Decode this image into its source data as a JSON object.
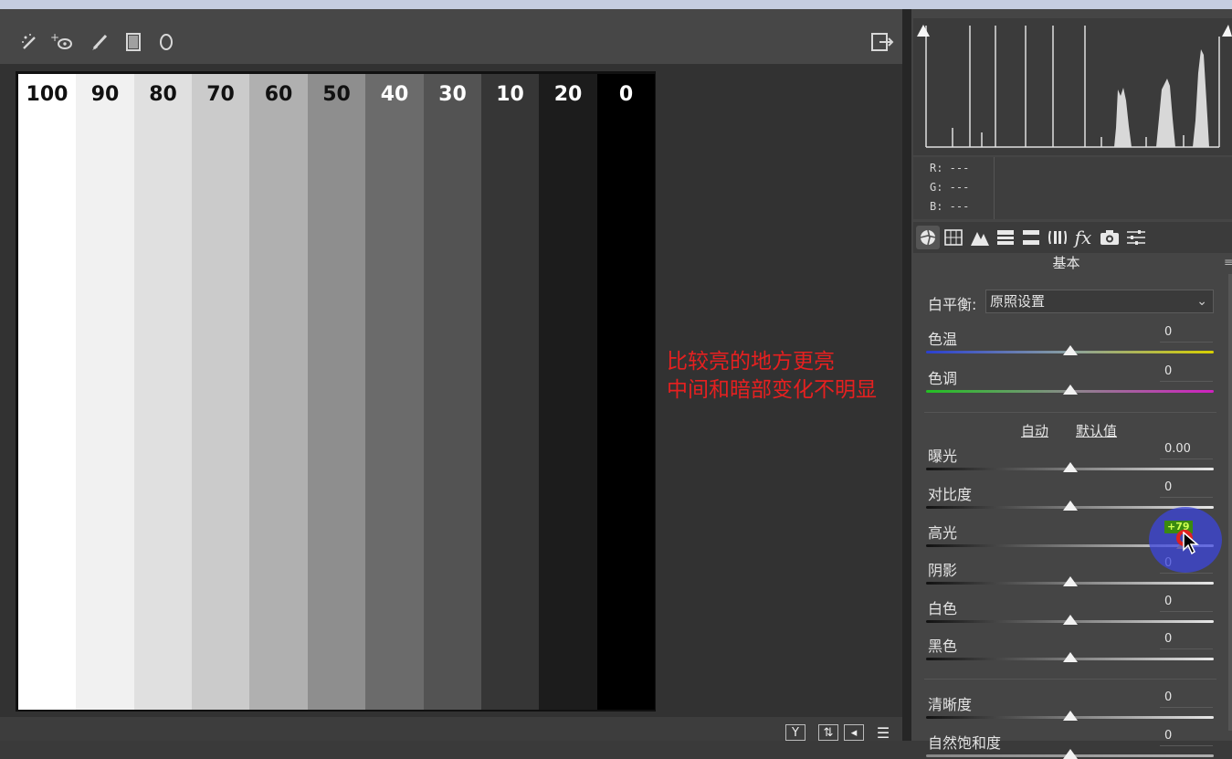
{
  "toolbar": {
    "tools": [
      {
        "name": "wand-brush-icon",
        "glyph": "⸗"
      },
      {
        "name": "spot-removal-icon",
        "glyph": "⁺⊙"
      },
      {
        "name": "adjustment-brush-icon",
        "glyph": "╱"
      },
      {
        "name": "graduated-filter-icon",
        "glyph": "▯"
      },
      {
        "name": "radial-filter-icon",
        "glyph": "◯"
      }
    ],
    "export_icon": "export-icon"
  },
  "canvas": {
    "stripes": [
      {
        "label": "100",
        "color": "#ffffff",
        "text": "#111111"
      },
      {
        "label": "90",
        "color": "#f1f1f1",
        "text": "#111111"
      },
      {
        "label": "80",
        "color": "#e0e0e0",
        "text": "#111111"
      },
      {
        "label": "70",
        "color": "#cbcbcb",
        "text": "#111111"
      },
      {
        "label": "60",
        "color": "#b0b0b0",
        "text": "#111111"
      },
      {
        "label": "50",
        "color": "#8e8e8e",
        "text": "#111111"
      },
      {
        "label": "40",
        "color": "#6b6b6b",
        "text": "#ffffff"
      },
      {
        "label": "30",
        "color": "#535353",
        "text": "#ffffff"
      },
      {
        "label": "10",
        "color": "#363636",
        "text": "#ffffff"
      },
      {
        "label": "20",
        "color": "#1c1c1c",
        "text": "#ffffff"
      },
      {
        "label": "0",
        "color": "#000000",
        "text": "#ffffff"
      }
    ]
  },
  "annotation": {
    "line1": "比较亮的地方更亮",
    "line2": "中间和暗部变化不明显",
    "color": "#e62020"
  },
  "readout": {
    "r": "R:  ---",
    "g": "G:  ---",
    "b": "B:  ---"
  },
  "panel": {
    "section_title": "基本",
    "white_balance": {
      "label": "白平衡:",
      "value": "原照设置"
    },
    "auto_label": "自动",
    "default_label": "默认值",
    "sliders": [
      {
        "label": "色温",
        "value": "0",
        "level": 0.5
      },
      {
        "label": "色调",
        "value": "0",
        "level": 0.5
      },
      {
        "label": "曝光",
        "value": "0.00",
        "level": 0.5
      },
      {
        "label": "对比度",
        "value": "0",
        "level": 0.5
      },
      {
        "label": "高光",
        "value": "+79",
        "level": 0.895
      },
      {
        "label": "阴影",
        "value": "0",
        "level": 0.5
      },
      {
        "label": "白色",
        "value": "0",
        "level": 0.5
      },
      {
        "label": "黑色",
        "value": "0",
        "level": 0.5
      },
      {
        "label": "清晰度",
        "value": "0",
        "level": 0.5
      },
      {
        "label": "自然饱和度",
        "value": "0",
        "level": 0.5
      }
    ],
    "cursor_badge": "+79"
  }
}
